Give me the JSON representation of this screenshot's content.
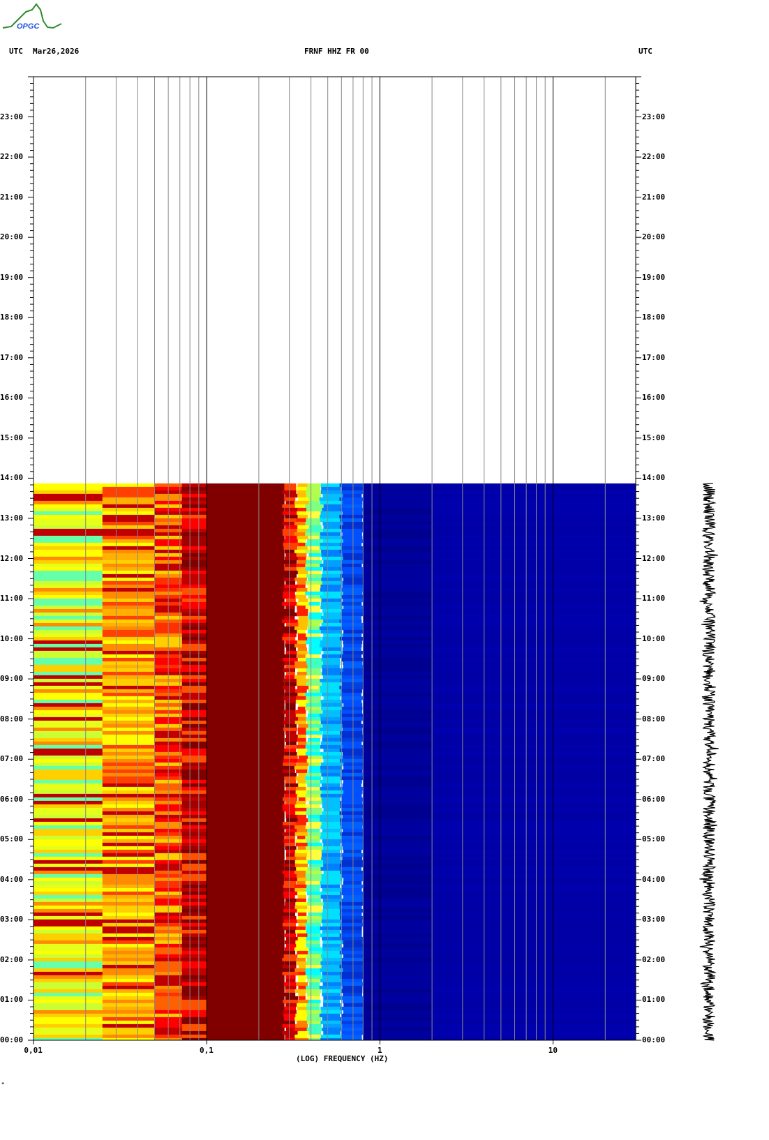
{
  "header": {
    "logo_text": "OPGC",
    "left_label": "UTC",
    "date": "Mar26,2026",
    "station": "FRNF HHZ FR 00",
    "right_label": "UTC"
  },
  "footer_mark": "*",
  "colors": {
    "white": "#ffffff",
    "darkred": "#800000",
    "navy": "#00008f",
    "blue": "#0000a8"
  },
  "chart_data": {
    "type": "heatmap",
    "title": "FRNF HHZ FR 00",
    "xlabel": "(LOG) FREQUENCY (HZ)",
    "ylabel": "UTC",
    "x_scale": "log",
    "xlim": [
      0.01,
      30
    ],
    "x_ticks": [
      {
        "value": 0.01,
        "label": "0,01"
      },
      {
        "value": 0.1,
        "label": "0,1"
      },
      {
        "value": 1,
        "label": "1"
      },
      {
        "value": 10,
        "label": "10"
      }
    ],
    "ylim_hours": [
      0,
      24
    ],
    "y_ticks": [
      "00:00",
      "01:00",
      "02:00",
      "03:00",
      "04:00",
      "05:00",
      "06:00",
      "07:00",
      "08:00",
      "09:00",
      "10:00",
      "11:00",
      "12:00",
      "13:00",
      "14:00",
      "15:00",
      "16:00",
      "17:00",
      "18:00",
      "19:00",
      "20:00",
      "21:00",
      "22:00",
      "23:00"
    ],
    "data_end_hour": 13.87,
    "bands": [
      {
        "f0": 0.01,
        "f1": 0.025,
        "palette": [
          "#ffff00",
          "#e6ff1a",
          "#ccff33",
          "#ffd000",
          "#ff8c00",
          "#66ffaa",
          "#c00000"
        ]
      },
      {
        "f0": 0.025,
        "f1": 0.05,
        "palette": [
          "#ff8c00",
          "#ffb000",
          "#ffd000",
          "#ff4000",
          "#c00000",
          "#ffff00"
        ]
      },
      {
        "f0": 0.05,
        "f1": 0.072,
        "palette": [
          "#ff3000",
          "#ff6000",
          "#c00000",
          "#ff9000",
          "#ffd000",
          "#ff0000"
        ]
      },
      {
        "f0": 0.072,
        "f1": 0.1,
        "palette": [
          "#a00000",
          "#c00000",
          "#ff0000",
          "#800000",
          "#ff5000"
        ]
      },
      {
        "f0": 0.1,
        "f1": 0.28,
        "palette": [
          "#800000"
        ]
      },
      {
        "f0": 0.28,
        "f1": 0.33,
        "palette": [
          "#800000",
          "#c00000",
          "#ff0000",
          "#ff4000"
        ]
      },
      {
        "f0": 0.33,
        "f1": 0.38,
        "palette": [
          "#ff2000",
          "#ff8000",
          "#ffc000",
          "#ffff00"
        ]
      },
      {
        "f0": 0.38,
        "f1": 0.46,
        "palette": [
          "#ffff40",
          "#b0ff50",
          "#40ffc0",
          "#00ffff",
          "#80ff80"
        ]
      },
      {
        "f0": 0.46,
        "f1": 0.6,
        "palette": [
          "#00c0ff",
          "#00a0ff",
          "#00e0ff",
          "#0080ff"
        ]
      },
      {
        "f0": 0.6,
        "f1": 0.8,
        "palette": [
          "#0050ff",
          "#0040e0",
          "#0060ff",
          "#0030d0"
        ]
      },
      {
        "f0": 0.8,
        "f1": 2.0,
        "palette": [
          "#00009a",
          "#000090",
          "#0000a0"
        ]
      },
      {
        "f0": 2.0,
        "f1": 30,
        "palette": [
          "#0000a8",
          "#0000ac",
          "#0000a4"
        ]
      }
    ]
  }
}
